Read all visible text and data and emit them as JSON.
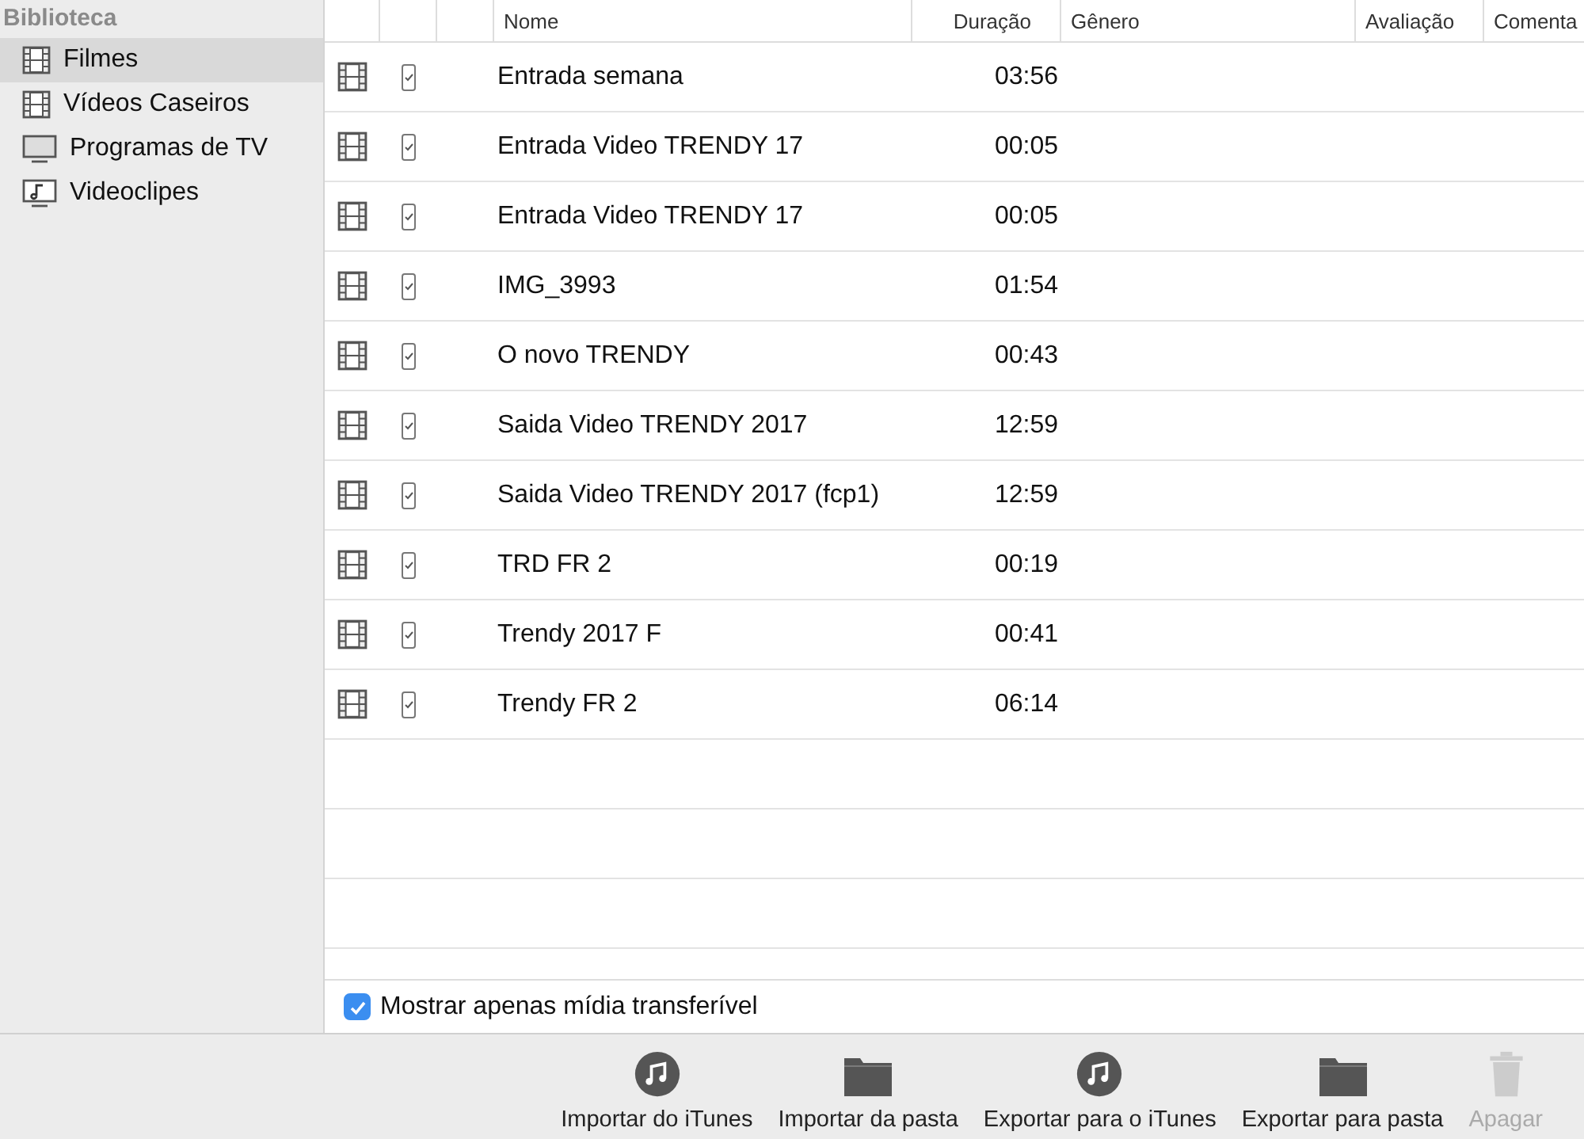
{
  "sidebar": {
    "heading": "Biblioteca",
    "items": [
      {
        "label": "Filmes",
        "kind": "film",
        "selected": true
      },
      {
        "label": "Vídeos Caseiros",
        "kind": "film",
        "selected": false
      },
      {
        "label": "Programas de TV",
        "kind": "tv",
        "selected": false
      },
      {
        "label": "Videoclipes",
        "kind": "music",
        "selected": false
      }
    ]
  },
  "table": {
    "columns": [
      "Nome",
      "Duração",
      "Gênero",
      "Avaliação",
      "Comenta"
    ],
    "rows": [
      {
        "name": "Entrada semana",
        "duration": "03:56"
      },
      {
        "name": "Entrada Video TRENDY 17",
        "duration": "00:05"
      },
      {
        "name": "Entrada Video TRENDY 17",
        "duration": "00:05"
      },
      {
        "name": "IMG_3993",
        "duration": "01:54"
      },
      {
        "name": "O novo TRENDY",
        "duration": "00:43"
      },
      {
        "name": "Saida Video TRENDY 2017",
        "duration": "12:59"
      },
      {
        "name": "Saida Video TRENDY 2017 (fcp1)",
        "duration": "12:59"
      },
      {
        "name": "TRD FR 2",
        "duration": "00:19"
      },
      {
        "name": "Trendy 2017 F",
        "duration": "00:41"
      },
      {
        "name": "Trendy FR 2",
        "duration": "06:14"
      }
    ]
  },
  "filter": {
    "label": "Mostrar apenas mídia transferível",
    "checked": true
  },
  "toolbar": [
    {
      "label": "Importar do iTunes",
      "kind": "music",
      "disabled": false
    },
    {
      "label": "Importar da pasta",
      "kind": "folder",
      "disabled": false
    },
    {
      "label": "Exportar para o iTunes",
      "kind": "music",
      "disabled": false
    },
    {
      "label": "Exportar para pasta",
      "kind": "folder",
      "disabled": false
    },
    {
      "label": "Apagar",
      "kind": "trash",
      "disabled": true
    }
  ]
}
